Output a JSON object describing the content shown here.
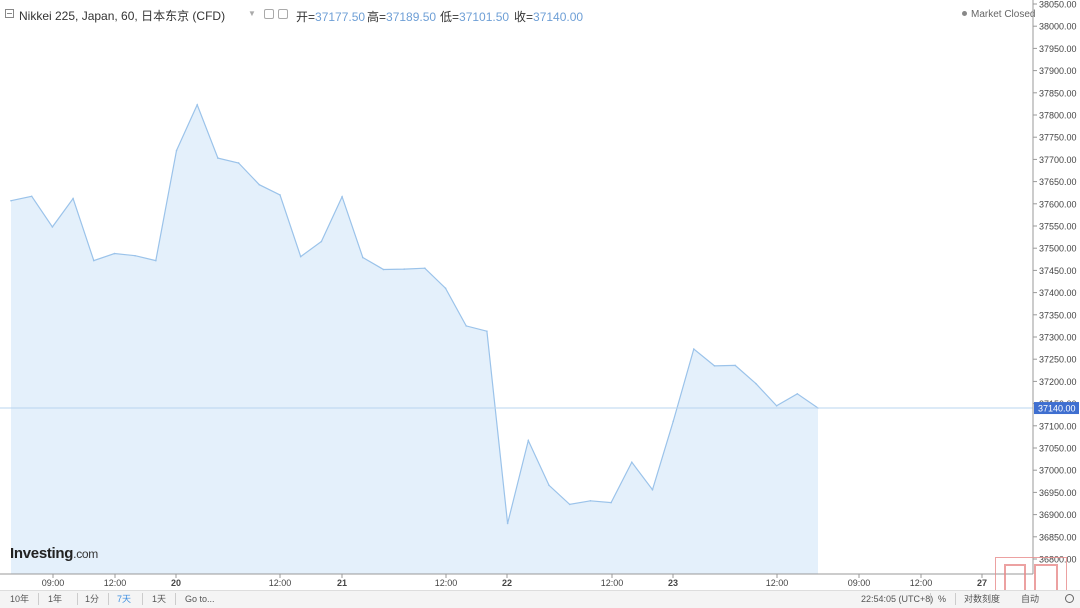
{
  "header": {
    "title": "Nikkei 225, Japan, 60, 日本东京 (CFD)",
    "open_label": "开=",
    "open_value": "37177.50",
    "high_label": "高=",
    "high_value": "37189.50",
    "low_label": "低=",
    "low_value": "37101.50",
    "close_label": "收=",
    "close_value": "37140.00",
    "market_status": "Market Closed"
  },
  "logo": {
    "main": "Investing",
    "sub": ".com"
  },
  "bottom_bar": {
    "ranges": [
      "10年",
      "1年",
      "1分",
      "7天",
      "1天",
      "Go to..."
    ],
    "active_range": "7天",
    "clock": "22:54:05 (UTC+8)",
    "percent_label": "%",
    "log_label": "对数刻度",
    "auto_label": "自动"
  },
  "chart_data": {
    "type": "area",
    "title": "Nikkei 225, Japan, 60, 日本东京 (CFD)",
    "xlabel": "",
    "ylabel": "",
    "ylim": [
      36800,
      38050
    ],
    "yticks": [
      36800,
      36850,
      36900,
      36950,
      37000,
      37050,
      37100,
      37150,
      37200,
      37250,
      37300,
      37350,
      37400,
      37450,
      37500,
      37550,
      37600,
      37650,
      37700,
      37750,
      37800,
      37850,
      37900,
      37950,
      38000,
      38050
    ],
    "ytick_labels": [
      "36800.00",
      "36850.00",
      "36900.00",
      "36950.00",
      "37000.00",
      "37050.00",
      "37100.00",
      "37150.00",
      "37200.00",
      "37250.00",
      "37300.00",
      "37350.00",
      "37400.00",
      "37450.00",
      "37500.00",
      "37550.00",
      "37600.00",
      "37650.00",
      "37700.00",
      "37750.00",
      "37800.00",
      "37850.00",
      "37900.00",
      "37950.00",
      "38000.00",
      "38050.00"
    ],
    "x_ticks": [
      "09:00",
      "12:00",
      "20",
      "12:00",
      "21",
      "12:00",
      "22",
      "12:00",
      "23",
      "12:00",
      "09:00",
      "12:00",
      "27"
    ],
    "last_price_label": "37140.00",
    "last_price": 37140,
    "line_color": "#9bc3ea",
    "fill_color": "#e4f0fb",
    "series": [
      {
        "values": [
          37607,
          37617,
          37548,
          37612,
          37472,
          37488,
          37483,
          37472,
          37720,
          37823,
          37703,
          37692,
          37643,
          37620,
          37481,
          37515,
          37616,
          37479,
          37452,
          37453,
          37455,
          37410,
          37325,
          37313,
          36880,
          37067,
          36966,
          36923,
          36931,
          36927,
          37018,
          36956,
          37110,
          37273,
          37235,
          37236,
          37195,
          37145,
          37172,
          37140
        ]
      }
    ]
  }
}
